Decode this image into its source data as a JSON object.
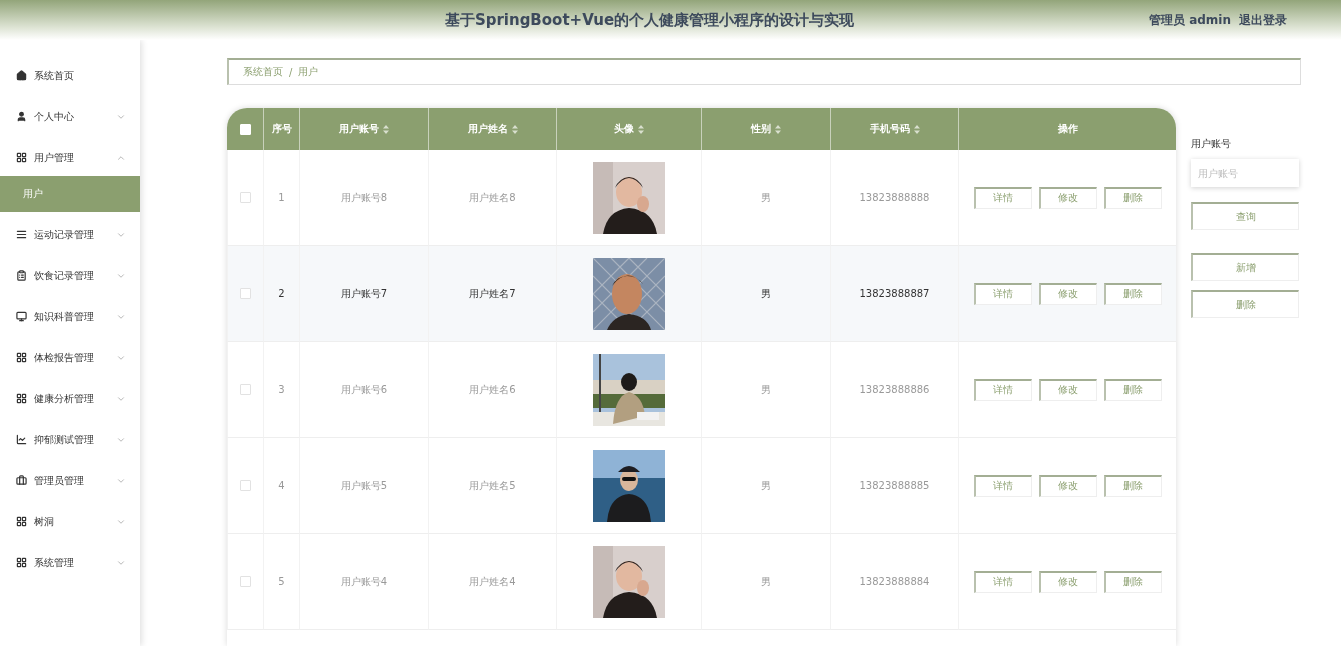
{
  "header": {
    "title": "基于SpringBoot+Vue的个人健康管理小程序的设计与实现",
    "user": "管理员 admin",
    "logout": "退出登录"
  },
  "sidebar": {
    "items": [
      {
        "label": "系统首页",
        "selected": false
      },
      {
        "label": "个人中心",
        "selected": false,
        "expanded": false
      },
      {
        "label": "用户管理",
        "selected": false,
        "expanded": true,
        "children": [
          {
            "label": "用户",
            "selected": true
          }
        ]
      },
      {
        "label": "运动记录管理",
        "selected": false,
        "expanded": false
      },
      {
        "label": "饮食记录管理",
        "selected": false,
        "expanded": false
      },
      {
        "label": "知识科普管理",
        "selected": false,
        "expanded": false
      },
      {
        "label": "体检报告管理",
        "selected": false,
        "expanded": false
      },
      {
        "label": "健康分析管理",
        "selected": false,
        "expanded": false
      },
      {
        "label": "抑郁测试管理",
        "selected": false,
        "expanded": false
      },
      {
        "label": "管理员管理",
        "selected": false,
        "expanded": false
      },
      {
        "label": "树洞",
        "selected": false,
        "expanded": false
      },
      {
        "label": "系统管理",
        "selected": false,
        "expanded": false
      }
    ]
  },
  "breadcrumb": [
    "系统首页",
    "/",
    "用户"
  ],
  "table": {
    "select_all": {
      "checked": false
    },
    "columns": [
      {
        "label": "序号",
        "sortable": false
      },
      {
        "label": "用户账号",
        "sortable": true
      },
      {
        "label": "用户姓名",
        "sortable": true
      },
      {
        "label": "头像",
        "sortable": true
      },
      {
        "label": "性别",
        "sortable": true
      },
      {
        "label": "手机号码",
        "sortable": true
      },
      {
        "label": "操作",
        "sortable": false
      }
    ],
    "rows": [
      {
        "index": "1",
        "account": "用户账号8",
        "name": "用户姓名8",
        "gender": "男",
        "phone": "13823888888",
        "checked": false,
        "highlighted": false,
        "actions": [
          "详情",
          "修改",
          "删除"
        ]
      },
      {
        "index": "2",
        "account": "用户账号7",
        "name": "用户姓名7",
        "gender": "男",
        "phone": "13823888887",
        "checked": false,
        "highlighted": true,
        "actions": [
          "详情",
          "修改",
          "删除"
        ]
      },
      {
        "index": "3",
        "account": "用户账号6",
        "name": "用户姓名6",
        "gender": "男",
        "phone": "13823888886",
        "checked": false,
        "highlighted": false,
        "actions": [
          "详情",
          "修改",
          "删除"
        ]
      },
      {
        "index": "4",
        "account": "用户账号5",
        "name": "用户姓名5",
        "gender": "男",
        "phone": "13823888885",
        "checked": false,
        "highlighted": false,
        "actions": [
          "详情",
          "修改",
          "删除"
        ]
      },
      {
        "index": "5",
        "account": "用户账号4",
        "name": "用户姓名4",
        "gender": "男",
        "phone": "13823888884",
        "checked": false,
        "highlighted": false,
        "actions": [
          "详情",
          "修改",
          "删除"
        ]
      }
    ]
  },
  "search": {
    "label": "用户账号",
    "placeholder": "用户账号",
    "query_button": "查询",
    "add_button": "新增",
    "delete_button": "删除"
  }
}
